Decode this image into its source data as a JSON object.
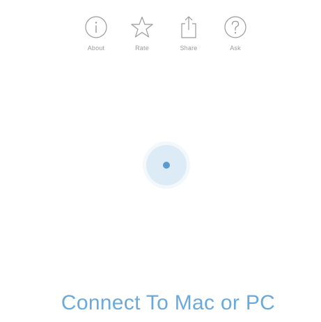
{
  "toolbar": {
    "about_label": "About",
    "rate_label": "Rate",
    "share_label": "Share",
    "ask_label": "Ask",
    "icons": [
      "info-icon",
      "star-icon",
      "share-icon",
      "question-icon"
    ]
  },
  "status": {
    "message": "Connect To Mac or PC"
  },
  "colors": {
    "accent_text": "#6aa9dc",
    "status_dot": "#5b9bd0",
    "status_ring": "#ddebf6",
    "icon_stroke": "#9a9a9a"
  }
}
